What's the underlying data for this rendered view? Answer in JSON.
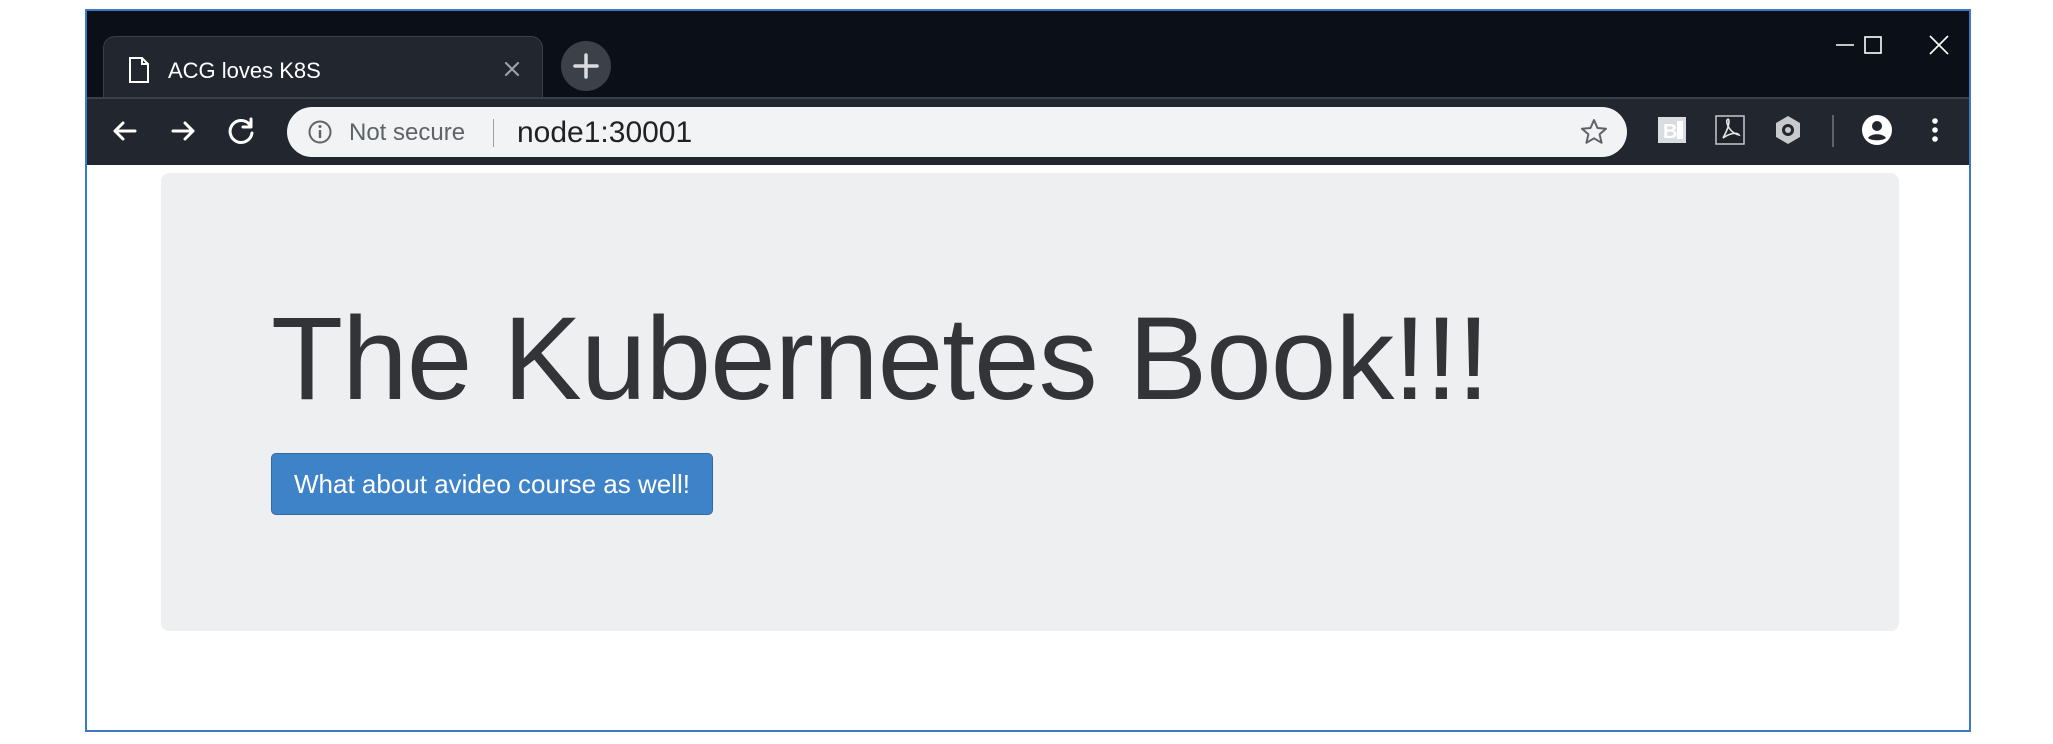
{
  "browser": {
    "tab": {
      "title": "ACG loves K8S",
      "icon": "document-icon"
    },
    "address_bar": {
      "security_label": "Not secure",
      "url": "node1:30001"
    },
    "icons": {
      "back": "arrow-left-icon",
      "forward": "arrow-right-icon",
      "reload": "reload-icon",
      "bookmark": "star-icon",
      "extensions": [
        "reader-extension-icon",
        "pdf-extension-icon",
        "hexagon-extension-icon"
      ],
      "profile": "account-icon",
      "menu": "kebab-menu-icon"
    },
    "colors": {
      "frame": "#0b0f17",
      "toolbar": "#22262e",
      "window_border": "#3d79c7"
    }
  },
  "page": {
    "heading": "The Kubernetes Book!!!",
    "cta_button_label": "What about avideo course as well!",
    "colors": {
      "jumbotron": "#eeeff0",
      "heading": "#333438",
      "button": "#3e82c7"
    }
  }
}
